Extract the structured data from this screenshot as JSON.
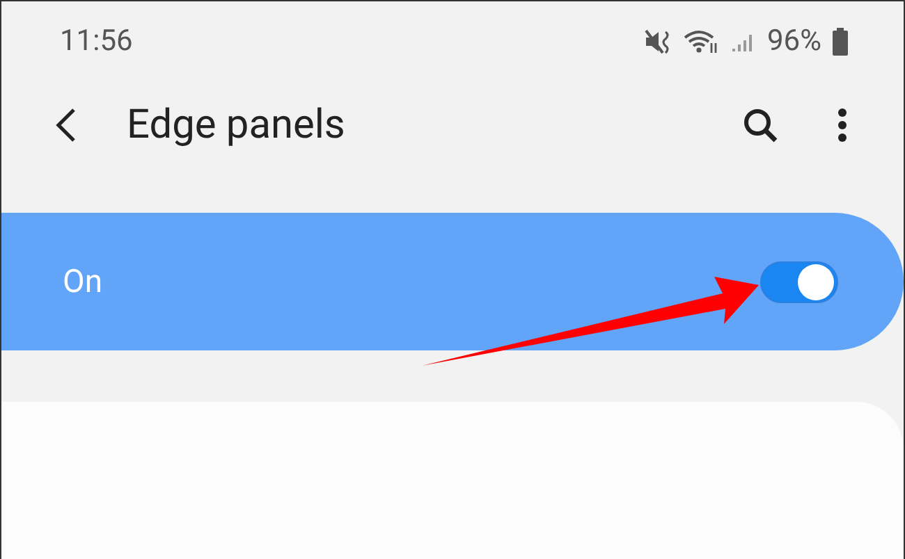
{
  "status_bar": {
    "time": "11:56",
    "battery": "96%"
  },
  "header": {
    "title": "Edge panels"
  },
  "master_switch": {
    "label": "On",
    "on": true
  }
}
